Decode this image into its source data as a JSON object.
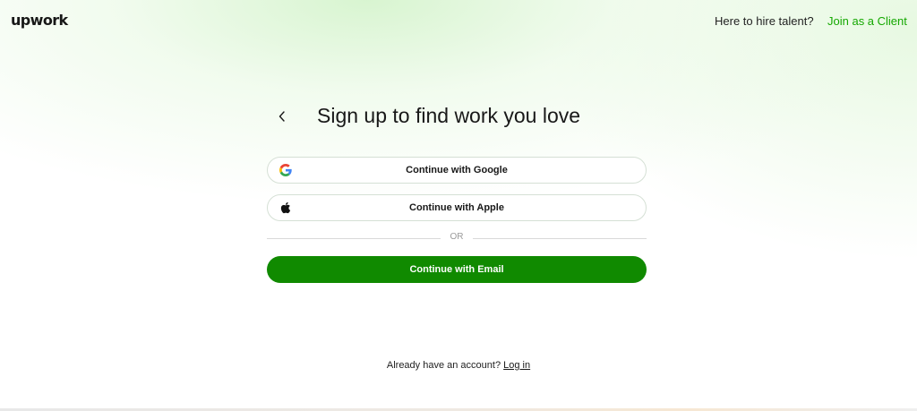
{
  "header": {
    "logo": "upwork",
    "hire_text": "Here to hire talent?",
    "join_link": "Join as a Client"
  },
  "main": {
    "title": "Sign up to find work you love",
    "google_label": "Continue with Google",
    "apple_label": "Continue with Apple",
    "divider_text": "OR",
    "email_label": "Continue with Email"
  },
  "footer": {
    "prompt": "Already have an account?",
    "login_link": "Log in"
  },
  "icons": {
    "back": "chevron-left-icon",
    "google": "google-icon",
    "apple": "apple-icon"
  },
  "colors": {
    "accent": "#14a800",
    "primary_button": "#108a00",
    "text": "#181818"
  }
}
